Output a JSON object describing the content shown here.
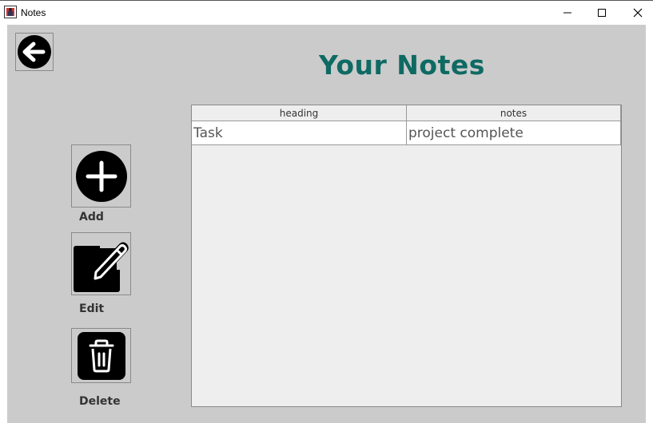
{
  "window": {
    "title": "Notes",
    "controls": {
      "minimize": "minimize",
      "maximize": "maximize",
      "close": "close"
    }
  },
  "page": {
    "title": "Your Notes",
    "title_color": "#0e6a63"
  },
  "actions": {
    "add_label": "Add",
    "edit_label": "Edit",
    "delete_label": "Delete"
  },
  "icons": {
    "back": "arrow-left-circle-icon",
    "add": "plus-circle-icon",
    "edit": "pencil-square-icon",
    "delete": "trash-icon"
  },
  "table": {
    "columns": [
      "heading",
      "notes"
    ],
    "rows": [
      [
        "Task",
        "project complete"
      ]
    ]
  }
}
